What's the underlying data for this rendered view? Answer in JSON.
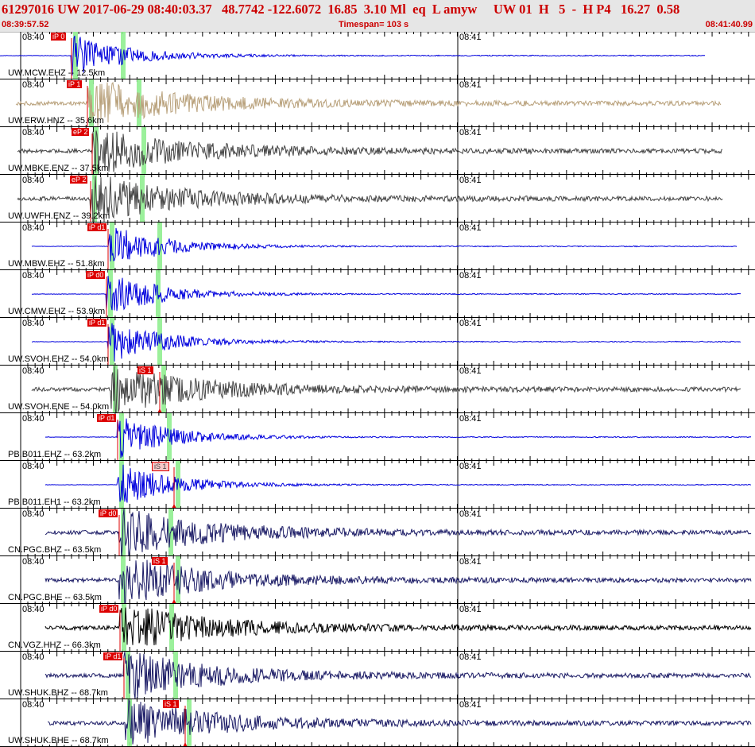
{
  "header": {
    "title": "61297016 UW 2017-06-29 08:40:03.37   48.7742 -122.6072  16.85  3.10 Ml  eq  L amyw     UW 01  H   5  -  H P4   16.27  0.58",
    "start_time": "08:39:57.52",
    "timespan": "Timespan= 103 s",
    "end_time": "08:41:40.99"
  },
  "colors": {
    "header_bg": "#e6e6e6",
    "header_text": "#cc0000",
    "pick": "#dd0000",
    "pick_window": "#90ee90",
    "trace_blue": "#0000dd",
    "trace_tan": "#b8a07a",
    "trace_gray": "#444444",
    "trace_navy": "#1c1c66",
    "trace_black": "#000000"
  },
  "panels": [
    {
      "station": "UW.MCW.EHZ -- 12.5km",
      "tick1": "08:40",
      "tick2": "08:41",
      "pick": "iP 0",
      "s_pick": "",
      "color": "#0000dd",
      "mode": "flat"
    },
    {
      "station": "UW.ERW.HNZ -- 35.6km",
      "tick1": "08:40",
      "tick2": "08:41",
      "pick": "iP 1",
      "s_pick": "",
      "color": "#b8a07a",
      "mode": "noise"
    },
    {
      "station": "UW.MBKE.ENZ -- 37.5km",
      "tick1": "08:40",
      "tick2": "08:41",
      "pick": "eP 2",
      "s_pick": "",
      "color": "#444444",
      "mode": "noise"
    },
    {
      "station": "UW.UWFH.ENZ -- 39.2km",
      "tick1": "08:40",
      "tick2": "08:41",
      "pick": "eP 2",
      "s_pick": "",
      "color": "#444444",
      "mode": "noise"
    },
    {
      "station": "UW.MBW.EHZ -- 51.8km",
      "tick1": "08:40",
      "tick2": "08:41",
      "pick": "iP d1",
      "s_pick": "",
      "color": "#0000dd",
      "mode": "flat"
    },
    {
      "station": "UW.CMW.EHZ -- 53.9km",
      "tick1": "08:40",
      "tick2": "08:41",
      "pick": "iP d0",
      "s_pick": "",
      "color": "#0000dd",
      "mode": "flat"
    },
    {
      "station": "UW.SVOH.EHZ -- 54.0km",
      "tick1": "08:40",
      "tick2": "08:41",
      "pick": "iP d1",
      "s_pick": "",
      "color": "#0000dd",
      "mode": "flat"
    },
    {
      "station": "UW.SVOH.ENE -- 54.0km",
      "tick1": "08:40",
      "tick2": "08:41",
      "pick": "",
      "s_pick": "iS 1",
      "color": "#444444",
      "mode": "noise"
    },
    {
      "station": "PB.B011.EHZ -- 63.2km",
      "tick1": "08:40",
      "tick2": "08:41",
      "pick": "iP d1",
      "s_pick": "",
      "color": "#0000dd",
      "mode": "flat"
    },
    {
      "station": "PB.B011.EH1 -- 63.2km",
      "tick1": "08:40",
      "tick2": "08:41",
      "pick": "",
      "s_pick": "iS 1",
      "color": "#0000dd",
      "mode": "flat"
    },
    {
      "station": "CN.PGC.BHZ -- 63.5km",
      "tick1": "08:40",
      "tick2": "08:41",
      "pick": "iP d0",
      "s_pick": "",
      "color": "#1c1c66",
      "mode": "noise"
    },
    {
      "station": "CN.PGC.BHE -- 63.5km",
      "tick1": "08:40",
      "tick2": "08:41",
      "pick": "",
      "s_pick": "iS 1",
      "color": "#1c1c66",
      "mode": "noise"
    },
    {
      "station": "CN.VGZ.HHZ -- 66.3km",
      "tick1": "08:40",
      "tick2": "08:41",
      "pick": "iP d0",
      "s_pick": "",
      "color": "#000000",
      "mode": "noise"
    },
    {
      "station": "UW.SHUK.BHZ -- 68.7km",
      "tick1": "08:40",
      "tick2": "08:41",
      "pick": "iP d1",
      "s_pick": "",
      "color": "#1c1c66",
      "mode": "noise"
    },
    {
      "station": "UW.SHUK.BHE -- 68.7km",
      "tick1": "08:40",
      "tick2": "08:41",
      "pick": "",
      "s_pick": "iS 1",
      "color": "#1c1c66",
      "mode": "noise"
    }
  ]
}
